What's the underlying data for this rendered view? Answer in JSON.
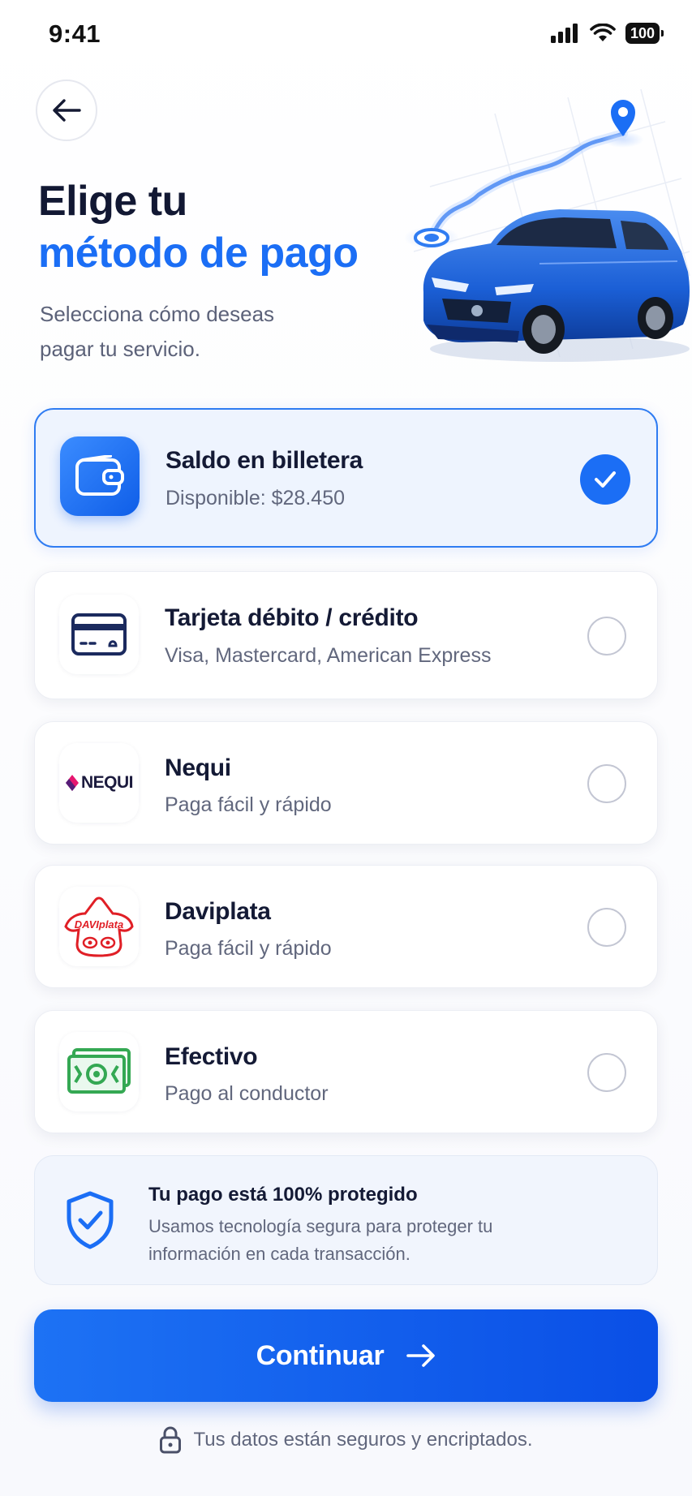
{
  "status_bar": {
    "time": "9:41",
    "battery": "100"
  },
  "header": {
    "title_line1": "Elige tu",
    "title_line2": "método de pago",
    "subtitle": "Selecciona cómo deseas pagar tu servicio."
  },
  "payment_methods": [
    {
      "name": "Saldo en billetera",
      "description": "Disponible: $28.450",
      "selected": true,
      "icon": "wallet-icon"
    },
    {
      "name": "Tarjeta débito / crédito",
      "description": "Visa, Mastercard, American Express",
      "selected": false,
      "icon": "credit-card-icon"
    },
    {
      "name": "Nequi",
      "description": "Paga fácil y rápido",
      "selected": false,
      "icon": "nequi-logo",
      "logo_text": "NEQUI"
    },
    {
      "name": "Daviplata",
      "description": "Paga fácil y rápido",
      "selected": false,
      "icon": "daviplata-logo",
      "logo_text": "DAVIplata"
    },
    {
      "name": "Efectivo",
      "description": "Pago al conductor",
      "selected": false,
      "icon": "cash-icon"
    }
  ],
  "security_notice": {
    "title": "Tu pago está 100% protegido",
    "text": "Usamos tecnología segura para proteger tu información en cada transacción."
  },
  "cta": {
    "label": "Continuar"
  },
  "footer": {
    "text": "Tus datos están seguros y encriptados."
  },
  "colors": {
    "accent": "#1b6ef5",
    "title_dark": "#121833",
    "selected_bg": "#eef4fe"
  }
}
